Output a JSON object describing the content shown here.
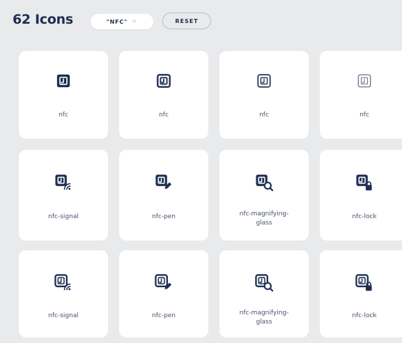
{
  "header": {
    "count_text": "62 Icons",
    "filter_chip": "\"NFC\"",
    "filter_clear_glyph": "×",
    "reset_label": "RESET"
  },
  "colors": {
    "background": "#e9eaec",
    "card": "#ffffff",
    "icon_dark": "#1e2e52",
    "text_muted": "#4a5167"
  },
  "cards": [
    {
      "label": "nfc",
      "icon": "nfc-icon",
      "variant": "solid"
    },
    {
      "label": "nfc",
      "icon": "nfc-icon",
      "variant": "bold"
    },
    {
      "label": "nfc",
      "icon": "nfc-icon",
      "variant": "regular"
    },
    {
      "label": "nfc",
      "icon": "nfc-icon",
      "variant": "light"
    },
    {
      "label": "nfc-signal",
      "icon": "nfc-signal-icon",
      "variant": "solid"
    },
    {
      "label": "nfc-pen",
      "icon": "nfc-pen-icon",
      "variant": "solid"
    },
    {
      "label": "nfc-magnifying-glass",
      "icon": "nfc-magnifying-glass-icon",
      "variant": "solid"
    },
    {
      "label": "nfc-lock",
      "icon": "nfc-lock-icon",
      "variant": "solid"
    },
    {
      "label": "nfc-signal",
      "icon": "nfc-signal-icon",
      "variant": "bold"
    },
    {
      "label": "nfc-pen",
      "icon": "nfc-pen-icon",
      "variant": "bold"
    },
    {
      "label": "nfc-magnifying-glass",
      "icon": "nfc-magnifying-glass-icon",
      "variant": "bold"
    },
    {
      "label": "nfc-lock",
      "icon": "nfc-lock-icon",
      "variant": "bold"
    }
  ]
}
